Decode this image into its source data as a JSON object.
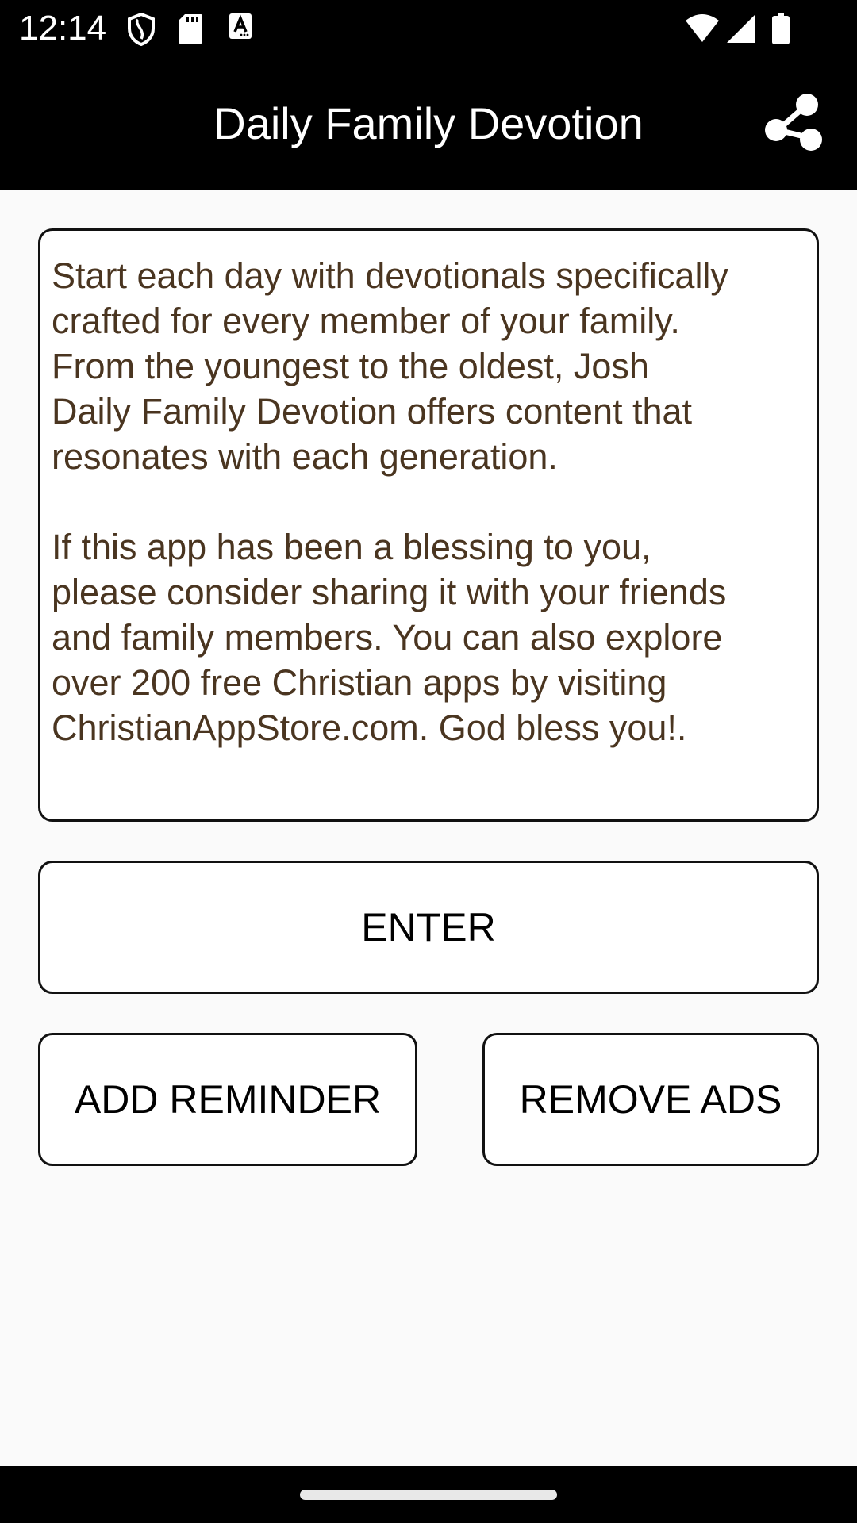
{
  "status_bar": {
    "time": "12:14",
    "left_icons": [
      "shield-icon",
      "sd-card-icon",
      "text-a-icon"
    ],
    "right_icons": [
      "wifi-icon",
      "signal-icon",
      "battery-icon"
    ]
  },
  "app_bar": {
    "title": "Daily Family Devotion",
    "share_icon": "share-icon"
  },
  "description": {
    "text": "Start each day with devotionals specifically\ncrafted for every member of your family.\nFrom the youngest to the oldest, Josh\nDaily Family Devotion offers content that\nresonates with each generation.\n\nIf this app has been a blessing to you,\nplease consider sharing it with your friends\nand family members. You can also explore\nover 200 free Christian apps by visiting\nChristianAppStore.com. God bless you!."
  },
  "buttons": {
    "enter": "ENTER",
    "add_reminder": "ADD REMINDER",
    "remove_ads": "REMOVE ADS"
  },
  "colors": {
    "bar_background": "#000000",
    "page_background": "#fafafa",
    "body_text": "#4a3520"
  }
}
